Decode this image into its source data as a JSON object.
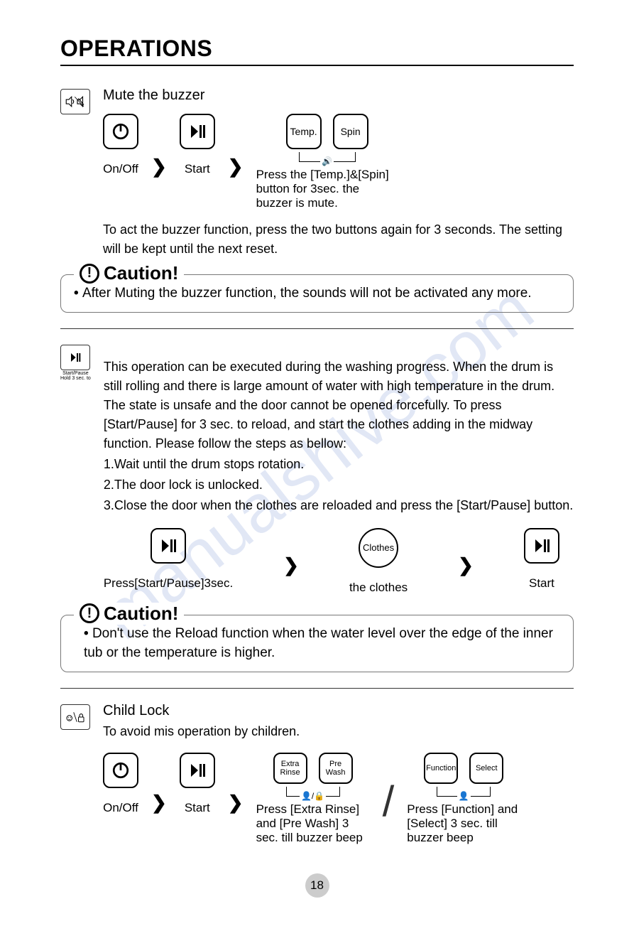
{
  "page_title": "OPERATIONS",
  "page_number": "18",
  "watermark": "manualshive.com",
  "mute": {
    "heading": "Mute the buzzer",
    "onoff_label": "On/Off",
    "start_label": "Start",
    "temp_btn": "Temp.",
    "spin_btn": "Spin",
    "press_desc": "Press the [Temp.]&[Spin] button for 3sec. the buzzer is mute.",
    "para": "To act the buzzer function, press the two buttons again for 3 seconds. The setting will be kept until the next reset.",
    "caution_title": "Caution!",
    "caution_text": "After Muting the buzzer function, the sounds will not be activated any more."
  },
  "reload": {
    "side_label": "Start/Pause",
    "side_sub": "Hold 3 sec. to",
    "para1": "This operation can be executed during the washing progress. When the drum is still rolling and there is large amount of water with high temperature in the drum. The state is unsafe and the door cannot be opened forcefully. To press [Start/Pause] for 3 sec. to reload, and start the clothes adding in the midway function. Please follow the steps as bellow:",
    "step1": "1.Wait until the drum stops rotation.",
    "step2": "2.The door lock is unlocked.",
    "step3": "3.Close the door when the clothes are reloaded and press the [Start/Pause] button.",
    "press_label": "Press[Start/Pause]3sec.",
    "clothes_icon": "Clothes",
    "clothes_label": "the clothes",
    "start_label": "Start",
    "caution_title": "Caution!",
    "caution_text": "Don't use the Reload function when the water level over the edge of the inner tub or the temperature is higher."
  },
  "childlock": {
    "heading": "Child Lock",
    "sub": "To avoid mis operation by children.",
    "onoff_label": "On/Off",
    "start_label": "Start",
    "extra_rinse_btn": "Extra Rinse",
    "pre_wash_btn": "Pre Wash",
    "combo1_desc": "Press [Extra Rinse] and [Pre Wash] 3 sec. till buzzer beep",
    "function_btn": "Function",
    "select_btn": "Select",
    "combo2_desc": "Press [Function] and [Select] 3 sec. till buzzer beep"
  }
}
